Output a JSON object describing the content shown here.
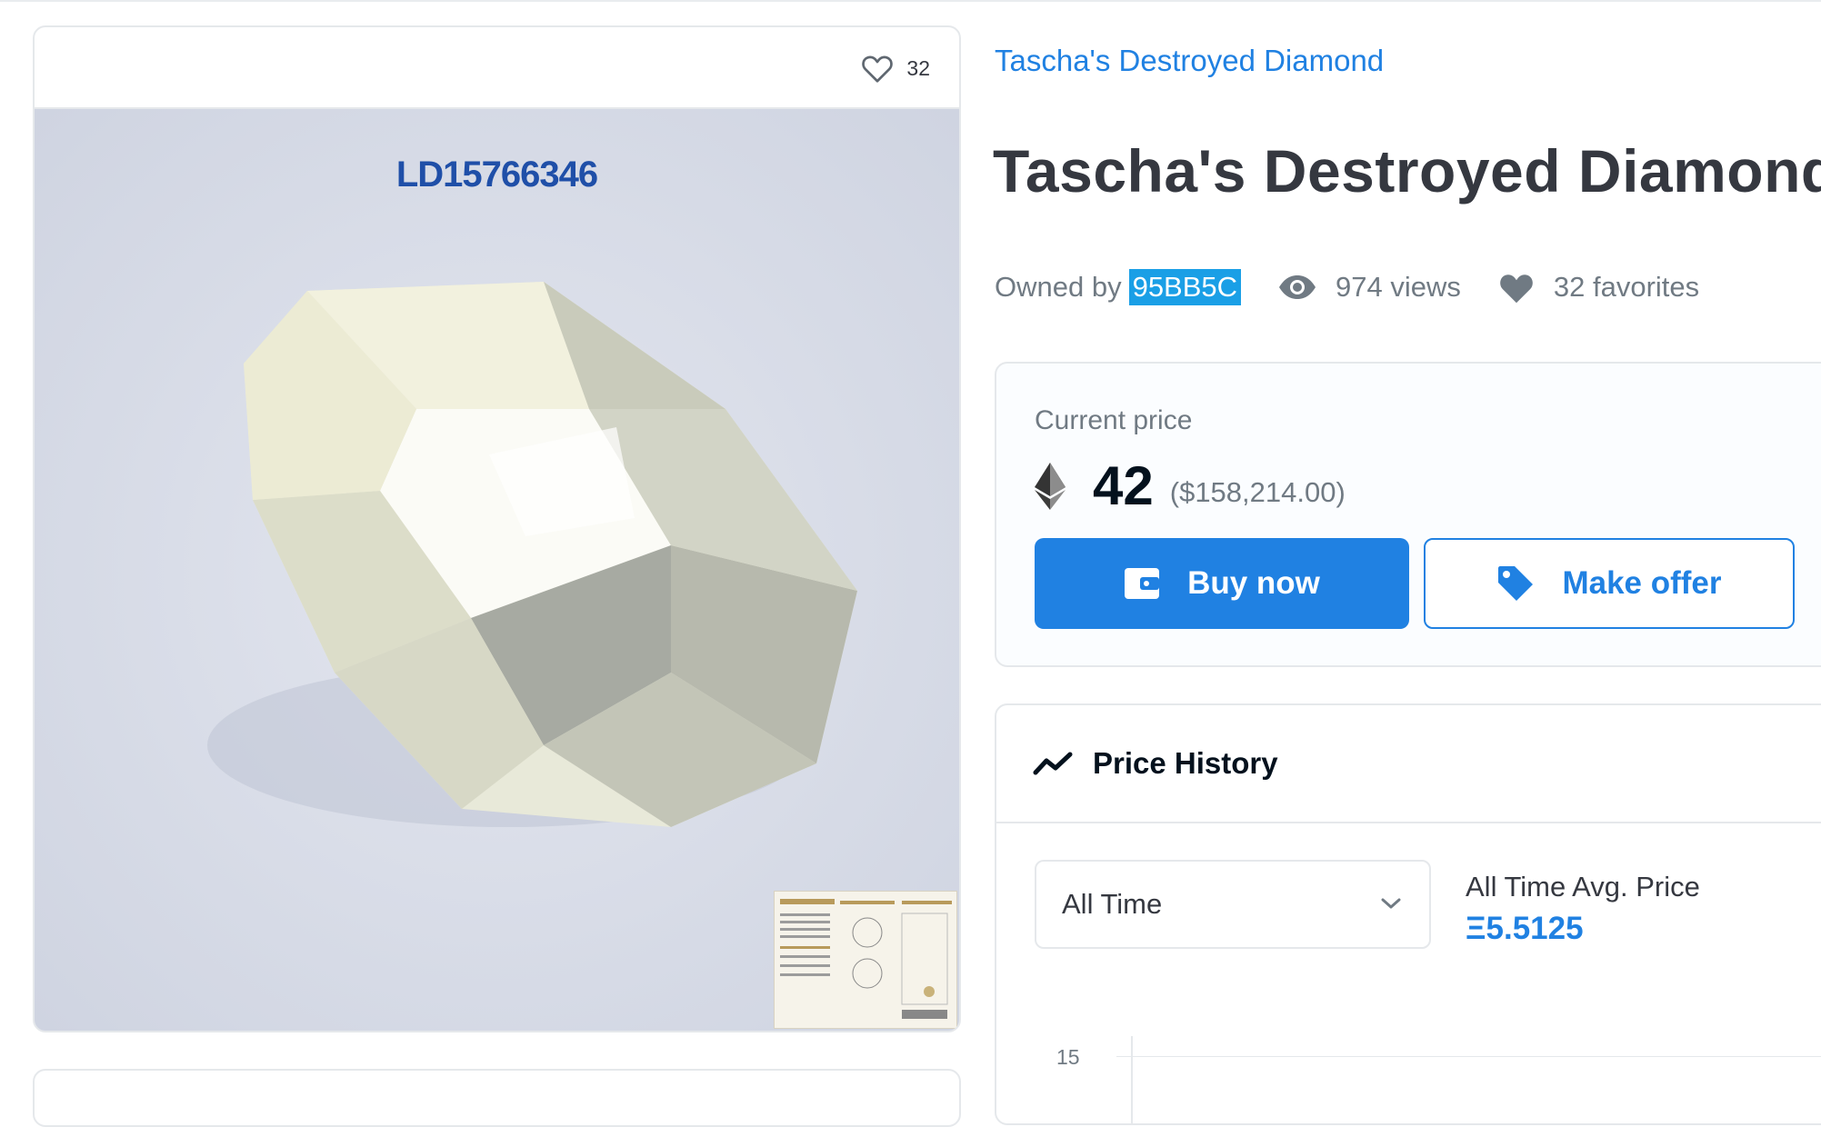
{
  "item": {
    "favorites_count": "32",
    "lot_id": "LD15766346",
    "collection_name": "Tascha's Destroyed Diamond",
    "title": "Tascha's Destroyed Diamond"
  },
  "meta": {
    "owned_by_label": "Owned by",
    "owner": "95BB5C",
    "views": "974 views",
    "favorites": "32 favorites"
  },
  "price": {
    "label": "Current price",
    "amount": "42",
    "usd": "($158,214.00)",
    "buy_label": "Buy now",
    "offer_label": "Make offer"
  },
  "history": {
    "title": "Price History",
    "range_selected": "All Time",
    "avg_label": "All Time Avg. Price",
    "avg_value": "Ξ5.5125",
    "y_tick": "15"
  },
  "colors": {
    "accent": "#2081e2",
    "text": "#353840",
    "muted": "#707a83"
  }
}
